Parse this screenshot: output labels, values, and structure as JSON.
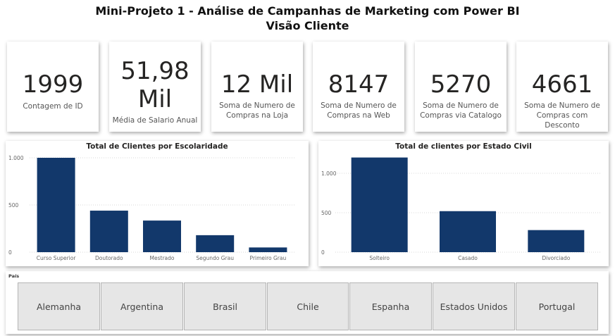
{
  "title_line1": "Mini-Projeto 1 - Análise de Campanhas de Marketing com Power BI",
  "title_line2": "Visão Cliente",
  "kpis": [
    {
      "value": "1999",
      "label": "Contagem de ID"
    },
    {
      "value_line1": "51,98",
      "value_line2": "Mil",
      "label": "Média de Salario Anual"
    },
    {
      "value": "12 Mil",
      "label_line1": "Soma de Numero de",
      "label_line2": "Compras na Loja"
    },
    {
      "value": "8147",
      "label_line1": "Soma de Numero de",
      "label_line2": "Compras na Web"
    },
    {
      "value": "5270",
      "label_line1": "Soma de Numero de",
      "label_line2": "Compras via Catalogo"
    },
    {
      "value": "4661",
      "label_line1": "Soma de Numero de",
      "label_line2": "Compras com Desconto"
    }
  ],
  "colors": {
    "bar": "#12386b",
    "grid": "#d9d9d9"
  },
  "chart_data": [
    {
      "type": "bar",
      "title": "Total de Clientes por Escolaridade",
      "categories": [
        "Curso Superior",
        "Doutorado",
        "Mestrado",
        "Segundo Grau",
        "Primeiro Grau"
      ],
      "values": [
        1000,
        440,
        335,
        180,
        50
      ],
      "ylim": [
        0,
        1000
      ],
      "yticks": [
        0,
        500,
        1000
      ],
      "ytick_labels": [
        "0",
        "500",
        "1.000"
      ],
      "grid": true
    },
    {
      "type": "bar",
      "title": "Total de clientes por Estado Civil",
      "categories": [
        "Solteiro",
        "Casado",
        "Divorciado"
      ],
      "values": [
        1200,
        520,
        280
      ],
      "ylim": [
        0,
        1000
      ],
      "yticks": [
        0,
        500,
        1000
      ],
      "ytick_labels": [
        "0",
        "500",
        "1.000"
      ],
      "grid": true
    }
  ],
  "slicer": {
    "title": "País",
    "options": [
      "Alemanha",
      "Argentina",
      "Brasil",
      "Chile",
      "Espanha",
      "Estados Unidos",
      "Portugal"
    ]
  }
}
